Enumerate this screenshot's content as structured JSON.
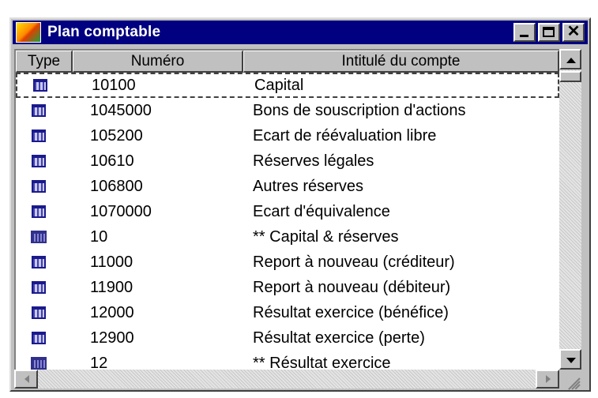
{
  "window": {
    "title": "Plan comptable"
  },
  "columns": [
    "Type",
    "Numéro",
    "Intitulé du compte"
  ],
  "rows": [
    {
      "type": "account",
      "number": "10100",
      "label": "Capital"
    },
    {
      "type": "account",
      "number": "1045000",
      "label": "Bons de souscription d'actions"
    },
    {
      "type": "account",
      "number": "105200",
      "label": "Ecart de réévaluation libre"
    },
    {
      "type": "account",
      "number": "10610",
      "label": "Réserves légales"
    },
    {
      "type": "account",
      "number": "106800",
      "label": "Autres réserves"
    },
    {
      "type": "account",
      "number": "1070000",
      "label": "Ecart d'équivalence"
    },
    {
      "type": "total",
      "number": "10",
      "label": "** Capital & réserves"
    },
    {
      "type": "account",
      "number": "11000",
      "label": "Report à nouveau (créditeur)"
    },
    {
      "type": "account",
      "number": "11900",
      "label": "Report à nouveau (débiteur)"
    },
    {
      "type": "account",
      "number": "12000",
      "label": "Résultat exercice (bénéfice)"
    },
    {
      "type": "account",
      "number": "12900",
      "label": "Résultat exercice (perte)"
    },
    {
      "type": "total",
      "number": "12",
      "label": "** Résultat exercice"
    }
  ],
  "selected_row": 0,
  "colors": {
    "titlebar": "#000080",
    "chrome": "#c0c0c0",
    "icon": "#4040b0"
  }
}
